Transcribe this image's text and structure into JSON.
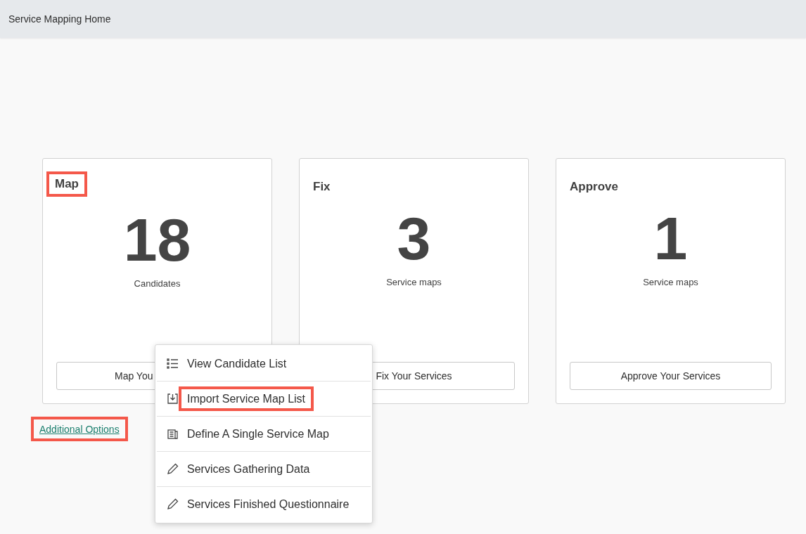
{
  "header": {
    "title": "Service Mapping Home"
  },
  "cards": [
    {
      "title": "Map",
      "highlighted": true,
      "count": "18",
      "caption": "Candidates",
      "button": "Map You"
    },
    {
      "title": "Fix",
      "highlighted": false,
      "count": "3",
      "caption": "Service maps",
      "button": "Fix Your Services"
    },
    {
      "title": "Approve",
      "highlighted": false,
      "count": "1",
      "caption": "Service maps",
      "button": "Approve Your Services"
    }
  ],
  "additional_options": {
    "label": "Additional Options",
    "highlighted": true
  },
  "menu": [
    {
      "label": "View Candidate List",
      "kind": "list",
      "highlighted": false
    },
    {
      "label": "Import Service Map List",
      "kind": "import",
      "highlighted": true
    },
    {
      "label": "Define A Single Service Map",
      "kind": "document",
      "highlighted": false
    },
    {
      "label": "Services Gathering Data",
      "kind": "edit",
      "highlighted": false
    },
    {
      "label": "Services Finished Questionnaire",
      "kind": "edit",
      "highlighted": false
    }
  ]
}
